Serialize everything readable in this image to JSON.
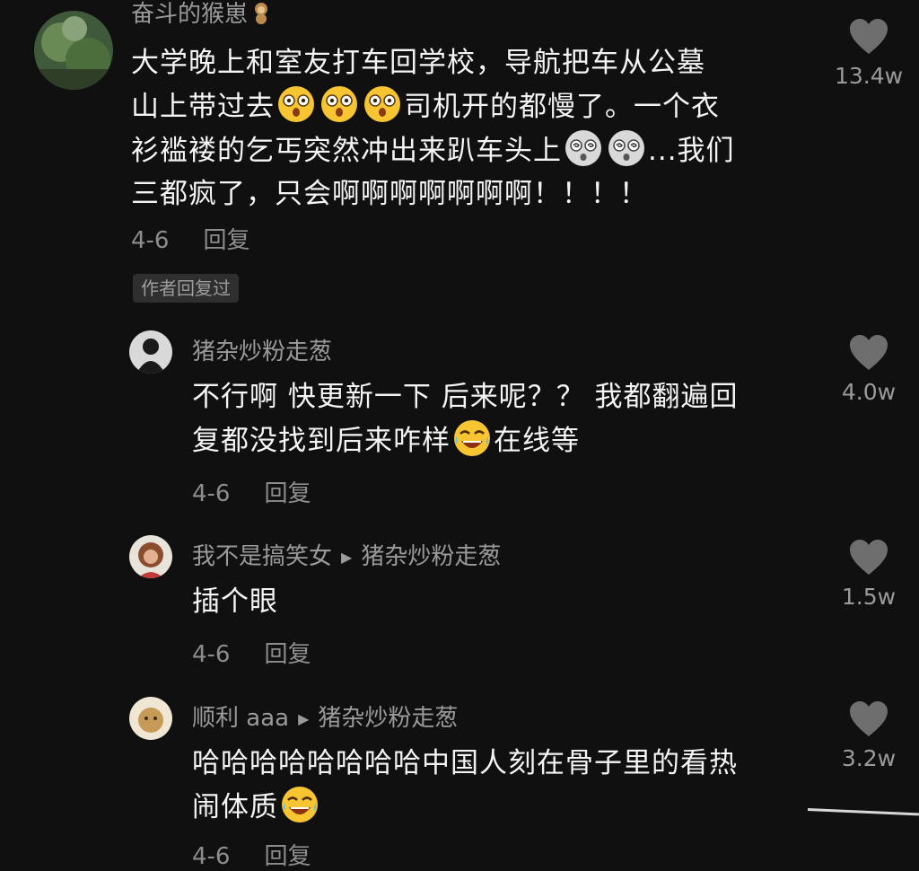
{
  "comments": [
    {
      "username": "奋斗的猴崽",
      "text_lines": [
        "大学晚上和室友打车回学校，导航把车从公墓",
        "山上带过去",
        "司机开的都慢了。一个衣",
        "衫褴褛的乞丐突然冲出来趴车头上",
        "...我们",
        "三都疯了，只会啊啊啊啊啊啊啊！！！！"
      ],
      "date": "4-6",
      "reply_label": "回复",
      "badge": "作者回复过",
      "likes": "13.4w"
    },
    {
      "username": "猪杂炒粉走葱",
      "text_lines": [
        "不行啊 快更新一下 后来呢？？ 我都翻遍回",
        "复都没找到后来咋样",
        "在线等"
      ],
      "date": "4-6",
      "reply_label": "回复",
      "likes": "4.0w"
    },
    {
      "username": "我不是搞笑女",
      "reply_to": "猪杂炒粉走葱",
      "text_lines": [
        "插个眼"
      ],
      "date": "4-6",
      "reply_label": "回复",
      "likes": "1.5w"
    },
    {
      "username": "顺利 aaa",
      "reply_to": "猪杂炒粉走葱",
      "text_lines": [
        "哈哈哈哈哈哈哈哈中国人刻在骨子里的看热",
        "闹体质"
      ],
      "date": "4-6",
      "reply_label": "回复",
      "likes": "3.2w"
    }
  ],
  "colors": {
    "background": "#101010",
    "text": "#f4f4f4",
    "muted": "#8d8d8d",
    "heart": "#6e6e6e"
  }
}
